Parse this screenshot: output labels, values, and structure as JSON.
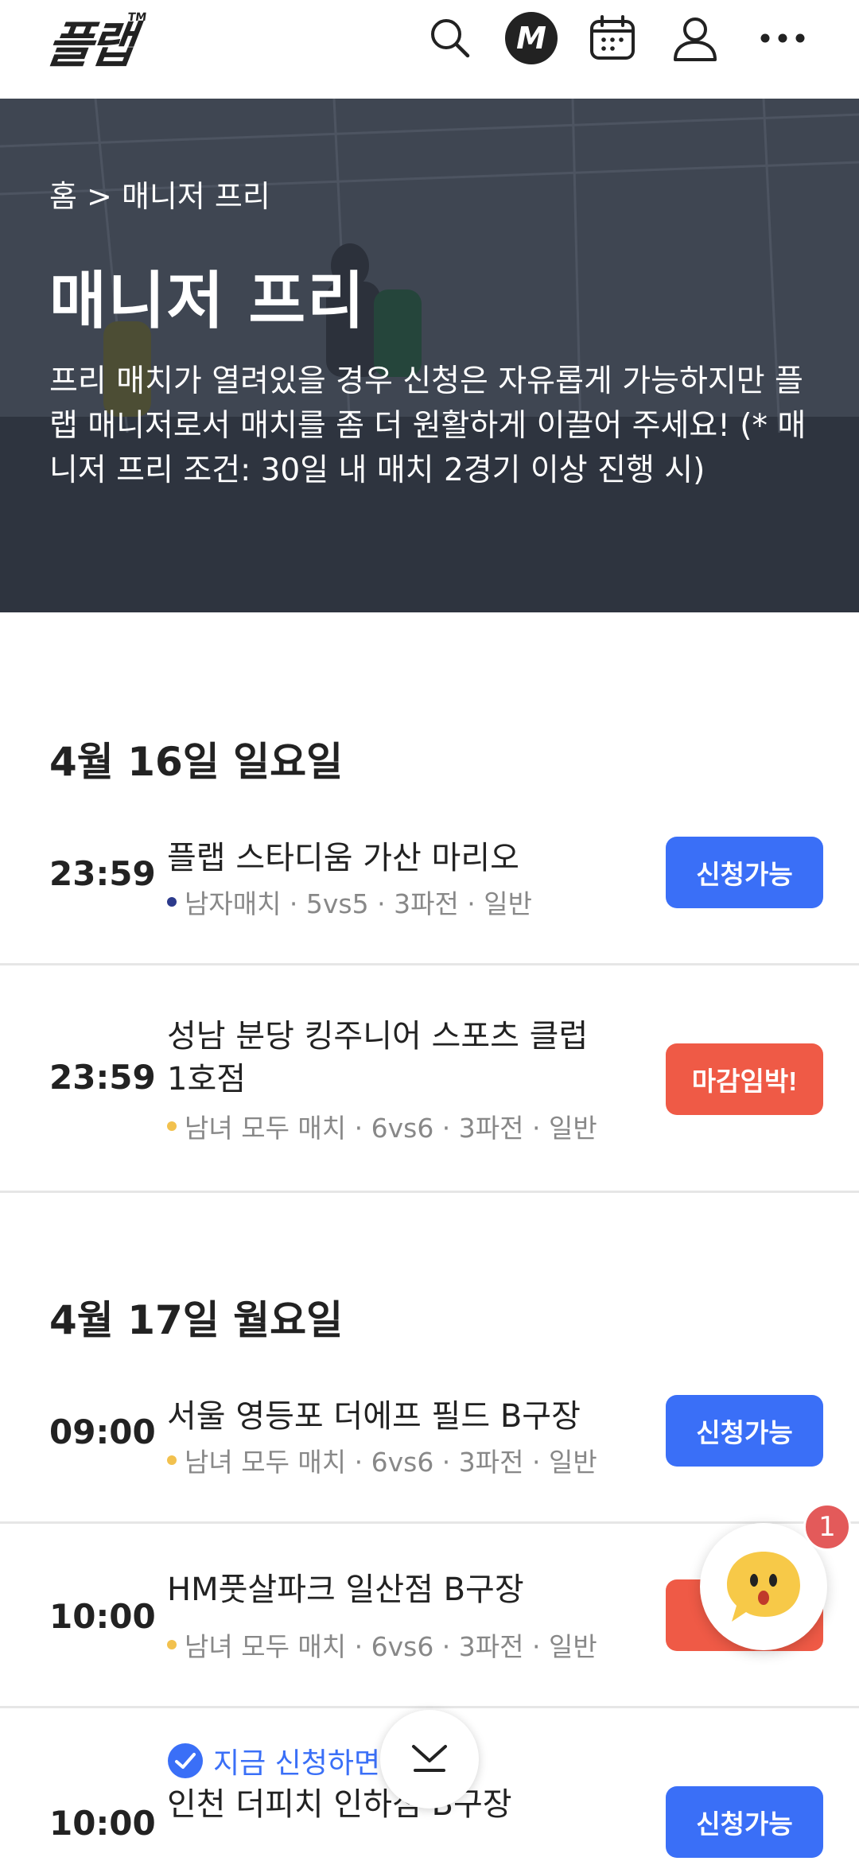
{
  "header": {
    "logo": "플랩",
    "logo_tm": "TM",
    "icons": [
      "search-icon",
      "manager-m-icon",
      "calendar-icon",
      "user-icon",
      "more-icon"
    ],
    "manager_letter": "M"
  },
  "hero": {
    "breadcrumb": "홈 > 매니저 프리",
    "title": "매니저 프리",
    "description": "프리 매치가 열려있을 경우 신청은 자유롭게 가능하지만 플랩 매니저로서 매치를 좀 더 원활하게 이끌어 주세요! (* 매니저 프리 조건: 30일 내 매치 2경기 이상 진행 시)"
  },
  "colors": {
    "accent_blue": "#3a6ff7",
    "urgent_red": "#ef5a46",
    "dot_navy": "#2c3a8c",
    "dot_yellow": "#f2c14e"
  },
  "days": [
    {
      "date": "4월 16일 일요일",
      "matches": [
        {
          "time": "23:59",
          "venue": "플랩 스타디움 가산 마리오",
          "meta": "남자매치 · 5vs5 · 3파전 · 일반",
          "dot": "navy",
          "status": "신청가능"
        },
        {
          "time": "23:59",
          "venue": "성남 분당 킹주니어 스포츠 클럽 1호점",
          "meta": "남녀 모두 매치 · 6vs6 · 3파전 · 일반",
          "dot": "yellow",
          "status": "마감임박!"
        }
      ]
    },
    {
      "date": "4월 17일 월요일",
      "matches": [
        {
          "time": "09:00",
          "venue": "서울 영등포 더에프 필드 B구장",
          "meta": "남녀 모두 매치 · 6vs6 · 3파전 · 일반",
          "dot": "yellow",
          "status": "신청가능"
        },
        {
          "time": "10:00",
          "venue": "HM풋살파크 일산점 B구장",
          "meta": "남녀 모두 매치 · 6vs6 · 3파전 · 일반",
          "dot": "yellow",
          "status": "마"
        },
        {
          "time": "10:00",
          "promo": "지금 신청하면 할인!",
          "venue": "인천 더피치 인하점 B구장",
          "status": "신청가능"
        }
      ]
    }
  ],
  "chat_badge": "1"
}
